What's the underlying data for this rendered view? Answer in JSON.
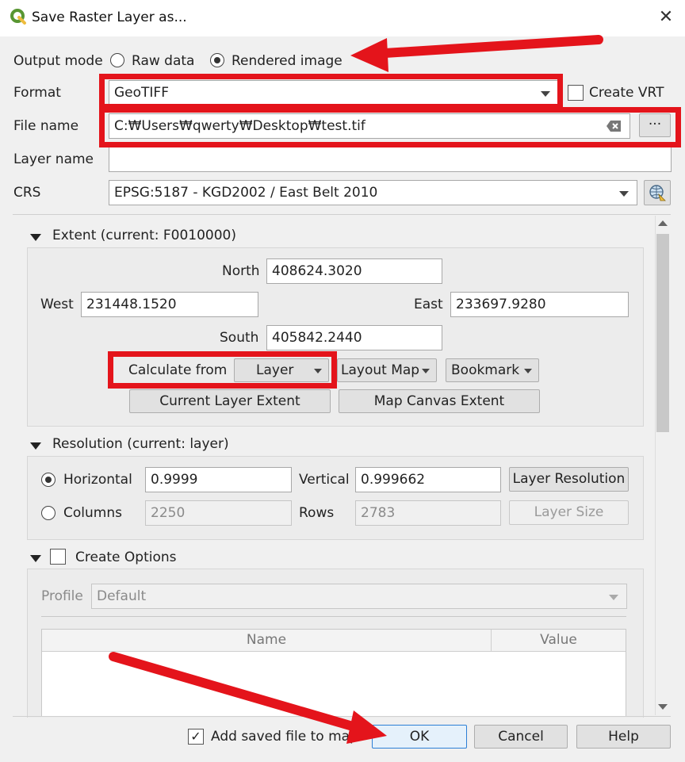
{
  "dialog": {
    "title": "Save Raster Layer as..."
  },
  "output_mode": {
    "label": "Output mode",
    "raw_label": "Raw data",
    "rendered_label": "Rendered image",
    "selected": "Rendered image"
  },
  "format": {
    "label": "Format",
    "value": "GeoTIFF",
    "create_vrt_label": "Create VRT"
  },
  "file_name": {
    "label": "File name",
    "value": "C:₩Users₩qwerty₩Desktop₩test.tif",
    "browse_label": "···"
  },
  "layer_name": {
    "label": "Layer name",
    "value": ""
  },
  "crs": {
    "label": "CRS",
    "value": "EPSG:5187 - KGD2002 / East Belt 2010"
  },
  "extent": {
    "title": "Extent (current: F0010000)",
    "north_label": "North",
    "north": "408624.3020",
    "west_label": "West",
    "west": "231448.1520",
    "east_label": "East",
    "east": "233697.9280",
    "south_label": "South",
    "south": "405842.2440",
    "calculate_from_label": "Calculate from",
    "layer_button": "Layer",
    "layout_map_button": "Layout Map",
    "bookmark_button": "Bookmark",
    "current_layer_extent_button": "Current Layer Extent",
    "map_canvas_extent_button": "Map Canvas Extent"
  },
  "resolution": {
    "title": "Resolution (current: layer)",
    "horizontal_label": "Horizontal",
    "horizontal": "0.9999",
    "vertical_label": "Vertical",
    "vertical": "0.999662",
    "layer_resolution_button": "Layer Resolution",
    "columns_label": "Columns",
    "columns": "2250",
    "rows_label": "Rows",
    "rows": "2783",
    "layer_size_button": "Layer Size"
  },
  "create_options": {
    "title": "Create Options",
    "profile_label": "Profile",
    "profile_value": "Default",
    "columns": [
      "Name",
      "Value"
    ]
  },
  "footer": {
    "add_saved_label": "Add saved file to map",
    "ok_label": "OK",
    "cancel_label": "Cancel",
    "help_label": "Help"
  },
  "colors": {
    "annotation_red": "#e4141b",
    "qgis_green": "#589632",
    "qgis_yellow": "#eebc3e"
  }
}
